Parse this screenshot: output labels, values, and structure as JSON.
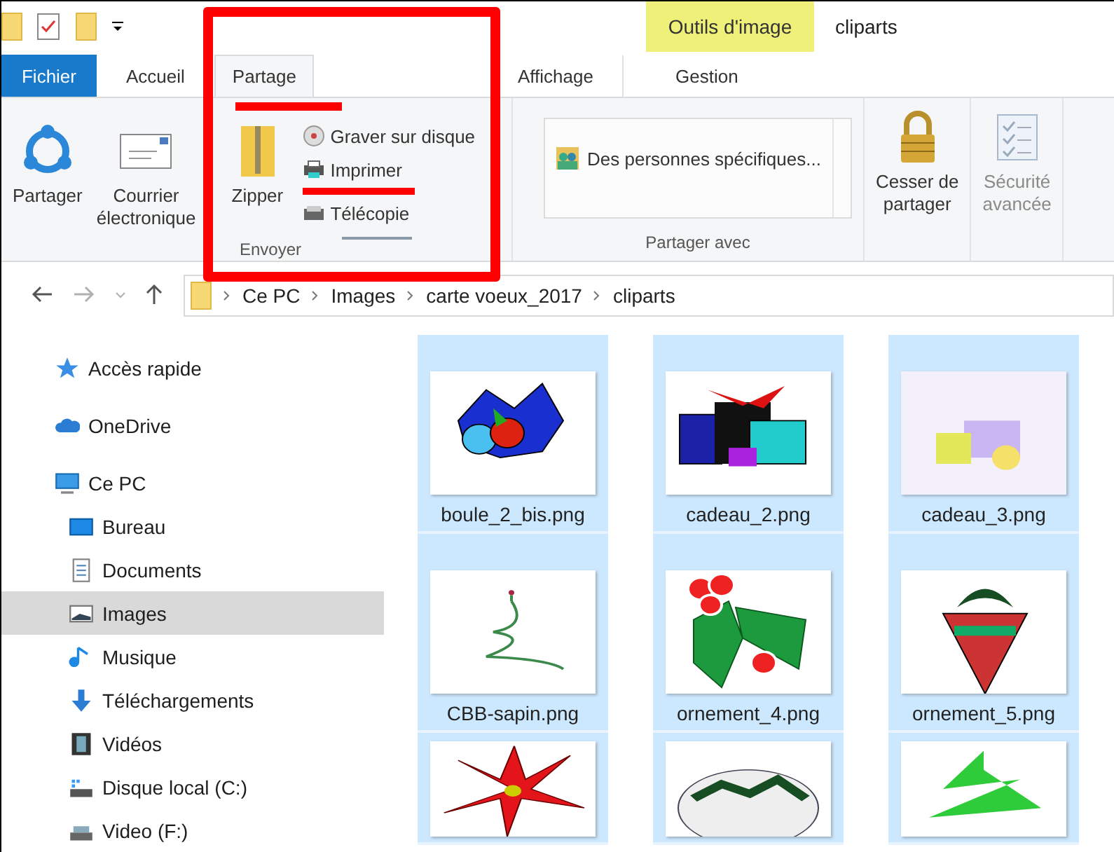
{
  "title_bar": {
    "context_header": "Outils d'image",
    "title": "cliparts"
  },
  "tabs": [
    {
      "label": "Fichier",
      "kind": "file",
      "selected": false,
      "underlined": false
    },
    {
      "label": "Accueil",
      "kind": "tab",
      "selected": false,
      "underlined": false
    },
    {
      "label": "Partage",
      "kind": "tab",
      "selected": true,
      "underlined": true
    },
    {
      "label": "Affichage",
      "kind": "tab",
      "selected": false,
      "underlined": false
    },
    {
      "label": "Gestion",
      "kind": "context",
      "selected": false,
      "underlined": false
    }
  ],
  "ribbon": {
    "send_group": {
      "label": "Envoyer",
      "highlighted": true,
      "large_buttons": [
        {
          "lines": [
            "Partager"
          ]
        },
        {
          "lines": [
            "Courrier",
            "électronique"
          ]
        },
        {
          "lines": [
            "Zipper"
          ]
        }
      ],
      "small_buttons": [
        {
          "label": "Graver sur disque",
          "underlined": false
        },
        {
          "label": "Imprimer",
          "underlined": true
        },
        {
          "label": "Télécopie",
          "underlined": false
        }
      ]
    },
    "share_group": {
      "label": "Partager avec",
      "list_item": "Des personnes spécifiques..."
    },
    "buttons": [
      {
        "lines": [
          "Cesser de",
          "partager"
        ],
        "disabled": false
      },
      {
        "lines": [
          "Sécurité",
          "avancée"
        ],
        "disabled": true
      }
    ]
  },
  "address_bar": {
    "path": [
      "Ce PC",
      "Images",
      "carte voeux_2017",
      "cliparts"
    ]
  },
  "nav": [
    {
      "label": "Accès rapide",
      "selected": false
    },
    {
      "label": "OneDrive",
      "selected": false
    },
    {
      "label": "Ce PC",
      "selected": false,
      "children": [
        {
          "label": "Bureau",
          "selected": false
        },
        {
          "label": "Documents",
          "selected": false
        },
        {
          "label": "Images",
          "selected": true
        },
        {
          "label": "Musique",
          "selected": false
        },
        {
          "label": "Téléchargements",
          "selected": false
        },
        {
          "label": "Vidéos",
          "selected": false
        },
        {
          "label": "Disque local (C:)",
          "selected": false
        },
        {
          "label": "Video (F:)",
          "selected": false
        }
      ]
    }
  ],
  "files": [
    {
      "name": "boule_2_bis.png",
      "selected": true
    },
    {
      "name": "cadeau_2.png",
      "selected": true
    },
    {
      "name": "cadeau_3.png",
      "selected": true
    },
    {
      "name": "CBB-sapin.png",
      "selected": true
    },
    {
      "name": "ornement_4.png",
      "selected": true
    },
    {
      "name": "ornement_5.png",
      "selected": true
    },
    {
      "selected": true
    },
    {
      "selected": true
    },
    {
      "selected": true
    }
  ]
}
